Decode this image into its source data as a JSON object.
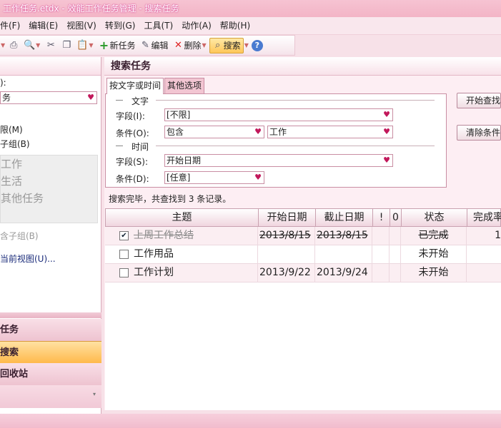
{
  "window": {
    "title": "工作任务.etdx - 效能工作任务管理 - 搜索任务"
  },
  "menu": [
    {
      "label": "件(F)"
    },
    {
      "label": "编辑(E)"
    },
    {
      "label": "视图(V)"
    },
    {
      "label": "转到(G)"
    },
    {
      "label": "工具(T)"
    },
    {
      "label": "动作(A)"
    },
    {
      "label": "帮助(H)"
    }
  ],
  "toolbar": {
    "new_task": "新任务",
    "edit": "编辑",
    "delete": "删除",
    "search": "搜索"
  },
  "left": {
    "filter_label": "):",
    "filter_value": "务",
    "option1": "限(M)",
    "option2": "子组(B)",
    "list_items": [
      "工作",
      "生活",
      "其他任务"
    ],
    "include_sub": "含子组(B)",
    "current_view": "当前视图(U)...",
    "nav": [
      "任务",
      "搜索",
      "回收站"
    ]
  },
  "search": {
    "title": "搜索任务",
    "tabs": [
      "按文字或时间",
      "其他选项"
    ],
    "section_text": "文字",
    "section_time": "时间",
    "field_label": "字段(I):",
    "field_value": "[不限]",
    "cond_label": "条件(O):",
    "cond_value": "包含",
    "cond_text_value": "工作",
    "time_field_label": "字段(S):",
    "time_field_value": "开始日期",
    "time_cond_label": "条件(D):",
    "time_cond_value": "[任意]",
    "start_button": "开始查找",
    "clear_button": "清除条件",
    "status": "搜索完毕，共查找到 3 条记录。"
  },
  "grid": {
    "columns": [
      "主题",
      "开始日期",
      "截止日期",
      "!",
      "0",
      "状态",
      "完成率"
    ],
    "rows": [
      {
        "checked": true,
        "subject": "上周工作总结",
        "start": "2013/8/15",
        "due": "2013/8/15",
        "status": "已完成",
        "done": true,
        "rate": "1"
      },
      {
        "checked": false,
        "subject": "工作用品",
        "start": "",
        "due": "",
        "status": "未开始",
        "done": false,
        "rate": ""
      },
      {
        "checked": false,
        "subject": "工作计划",
        "start": "2013/9/22",
        "due": "2013/9/24",
        "status": "未开始",
        "done": false,
        "rate": ""
      }
    ]
  }
}
